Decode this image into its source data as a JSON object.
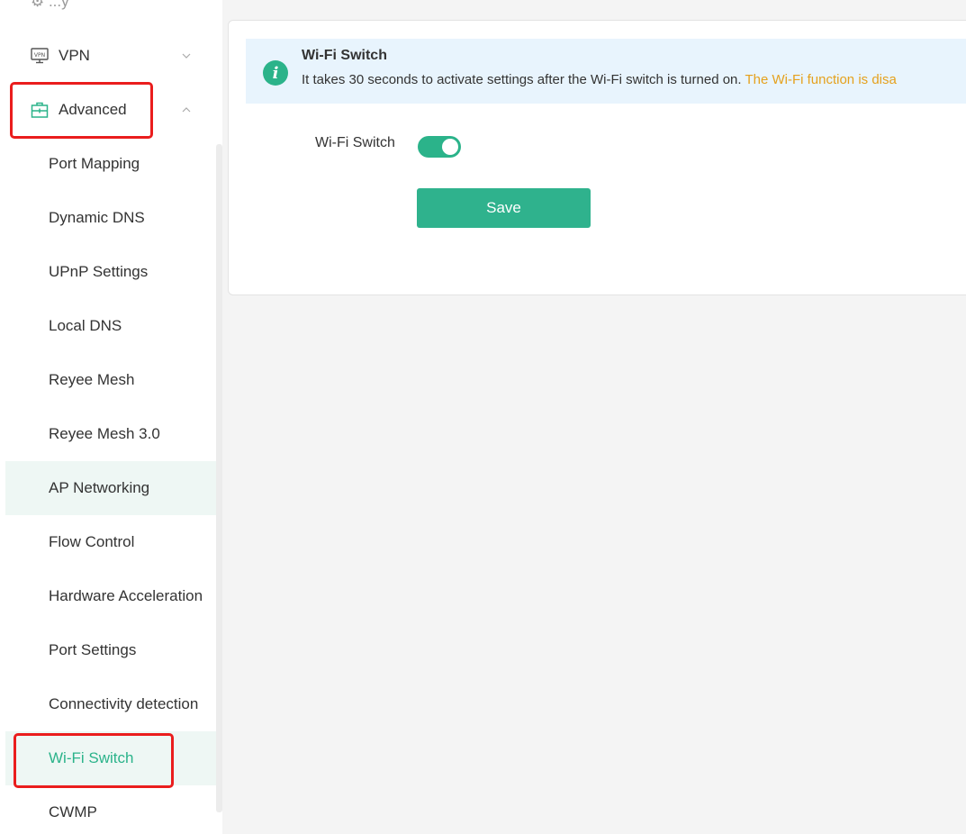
{
  "sidebar": {
    "partial_item": "⚙ ...y",
    "groups": [
      {
        "label": "VPN",
        "icon": "vpn-icon",
        "state": "collapsed"
      },
      {
        "label": "Advanced",
        "icon": "toolbox-icon",
        "state": "expanded"
      }
    ],
    "sub_items": [
      {
        "label": "Port Mapping"
      },
      {
        "label": "Dynamic DNS"
      },
      {
        "label": "UPnP Settings"
      },
      {
        "label": "Local DNS"
      },
      {
        "label": "Reyee Mesh"
      },
      {
        "label": "Reyee Mesh 3.0"
      },
      {
        "label": "AP Networking",
        "state": "hover"
      },
      {
        "label": "Flow Control"
      },
      {
        "label": "Hardware Acceleration"
      },
      {
        "label": "Port Settings"
      },
      {
        "label": "Connectivity detection"
      },
      {
        "label": "Wi-Fi Switch",
        "state": "active"
      },
      {
        "label": "CWMP"
      }
    ]
  },
  "main": {
    "alert": {
      "icon": "info-icon",
      "title": "Wi-Fi Switch",
      "description": "It takes 30 seconds to activate settings after the Wi-Fi switch is turned on. ",
      "warning": "The Wi-Fi function is disa"
    },
    "switch_label": "Wi-Fi Switch",
    "switch_on": true,
    "save_label": "Save"
  },
  "colors": {
    "accent": "#2bb38a",
    "highlight": "#ea1d1d",
    "warning": "#e5a11d",
    "alert_bg": "#e8f4fd"
  }
}
